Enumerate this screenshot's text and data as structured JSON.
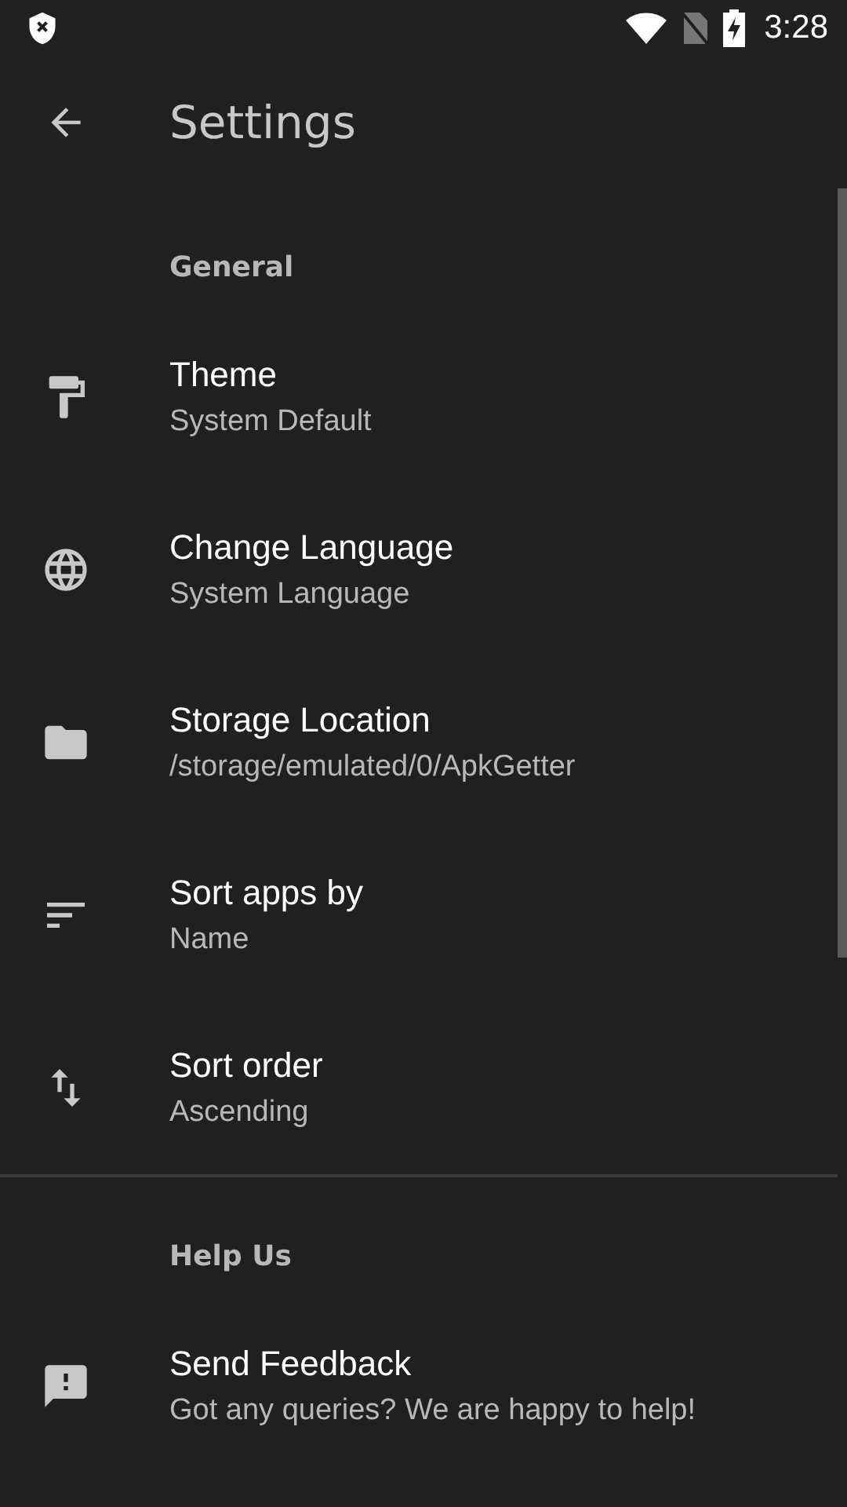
{
  "status_bar": {
    "time": "3:28"
  },
  "toolbar": {
    "title": "Settings"
  },
  "sections": [
    {
      "header": "General",
      "divider": true,
      "items": [
        {
          "title": "Theme",
          "summary": "System Default"
        },
        {
          "title": "Change Language",
          "summary": "System Language"
        },
        {
          "title": "Storage Location",
          "summary": "/storage/emulated/0/ApkGetter"
        },
        {
          "title": "Sort apps by",
          "summary": "Name"
        },
        {
          "title": "Sort order",
          "summary": "Ascending"
        }
      ]
    },
    {
      "header": "Help Us",
      "divider": false,
      "items": [
        {
          "title": "Send Feedback",
          "summary": "Got any queries? We are happy to help!"
        }
      ]
    }
  ]
}
